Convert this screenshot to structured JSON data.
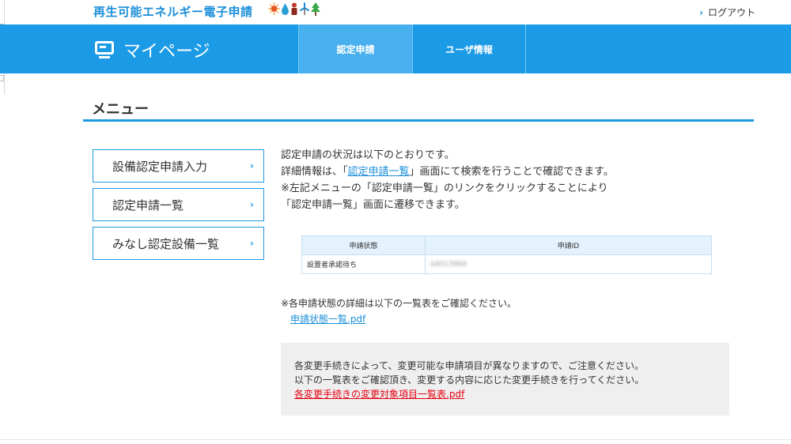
{
  "header": {
    "site_title": "再生可能エネルギー電子申請",
    "logout_label": "ログアウト"
  },
  "nav": {
    "mypage_label": "マイページ",
    "tabs": [
      {
        "label": "認定申請",
        "active": true
      },
      {
        "label": "ユーザ情報",
        "active": false
      }
    ]
  },
  "menu": {
    "title": "メニュー",
    "items": [
      {
        "label": "設備認定申請入力"
      },
      {
        "label": "認定申請一覧"
      },
      {
        "label": "みなし認定設備一覧"
      }
    ]
  },
  "intro": {
    "line1": "認定申請の状況は以下のとおりです。",
    "line2_prefix": "詳細情報は、「",
    "line2_link": "認定申請一覧",
    "line2_suffix": "」画面にて検索を行うことで確認できます。",
    "line3": "※左記メニューの「認定申請一覧」のリンクをクリックすることにより",
    "line4": "「認定申請一覧」画面に遷移できます。"
  },
  "status_table": {
    "headers": [
      "申請状態",
      "申請ID"
    ],
    "rows": [
      [
        "設置者承諾待ち",
        "04013969"
      ]
    ]
  },
  "status_note": {
    "text": "※各申請状態の詳細は以下の一覧表をご確認ください。",
    "link": "申請状態一覧.pdf"
  },
  "notice": {
    "line1": "各変更手続きによって、変更可能な申請項目が異なりますので、ご注意ください。",
    "line2": "以下の一覧表をご確認頂き、変更する内容に応じた変更手続きを行ってください。",
    "link": "各変更手続きの変更対象項目一覧表.pdf"
  },
  "colors": {
    "accent": "#1b9ae6",
    "active_tab": "#48b0ee",
    "link": "#1b8fd8",
    "warning_link": "#e60012"
  }
}
